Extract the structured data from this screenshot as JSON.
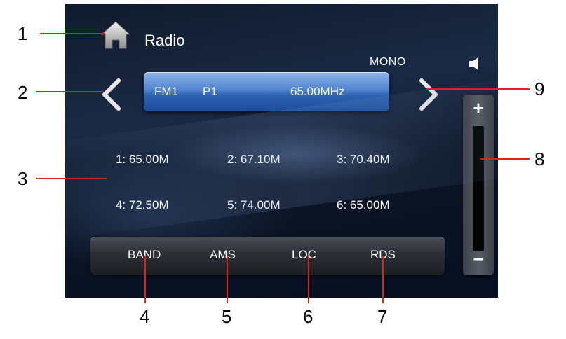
{
  "screen": {
    "title": "Radio",
    "stereo_mode": "MONO",
    "frequency_bar": {
      "band": "FM1",
      "preset": "P1",
      "frequency": "65.00MHz"
    },
    "presets": [
      {
        "label": "1: 65.00M"
      },
      {
        "label": "2: 67.10M"
      },
      {
        "label": "3: 70.40M"
      },
      {
        "label": "4: 72.50M"
      },
      {
        "label": "5: 74.00M"
      },
      {
        "label": "6: 65.00M"
      }
    ],
    "buttons": {
      "band": "BAND",
      "ams": "AMS",
      "loc": "LOC",
      "rds": "RDS"
    },
    "volume": {
      "plus": "+",
      "minus": "–"
    },
    "icons": {
      "home": "home-icon",
      "speaker": "speaker-icon",
      "prev": "chevron-left-icon",
      "next": "chevron-right-icon"
    },
    "colors": {
      "frequency_bar": "#3f74c4",
      "callout_line": "#d9261c"
    }
  },
  "callouts": [
    "1",
    "2",
    "3",
    "4",
    "5",
    "6",
    "7",
    "8",
    "9"
  ]
}
